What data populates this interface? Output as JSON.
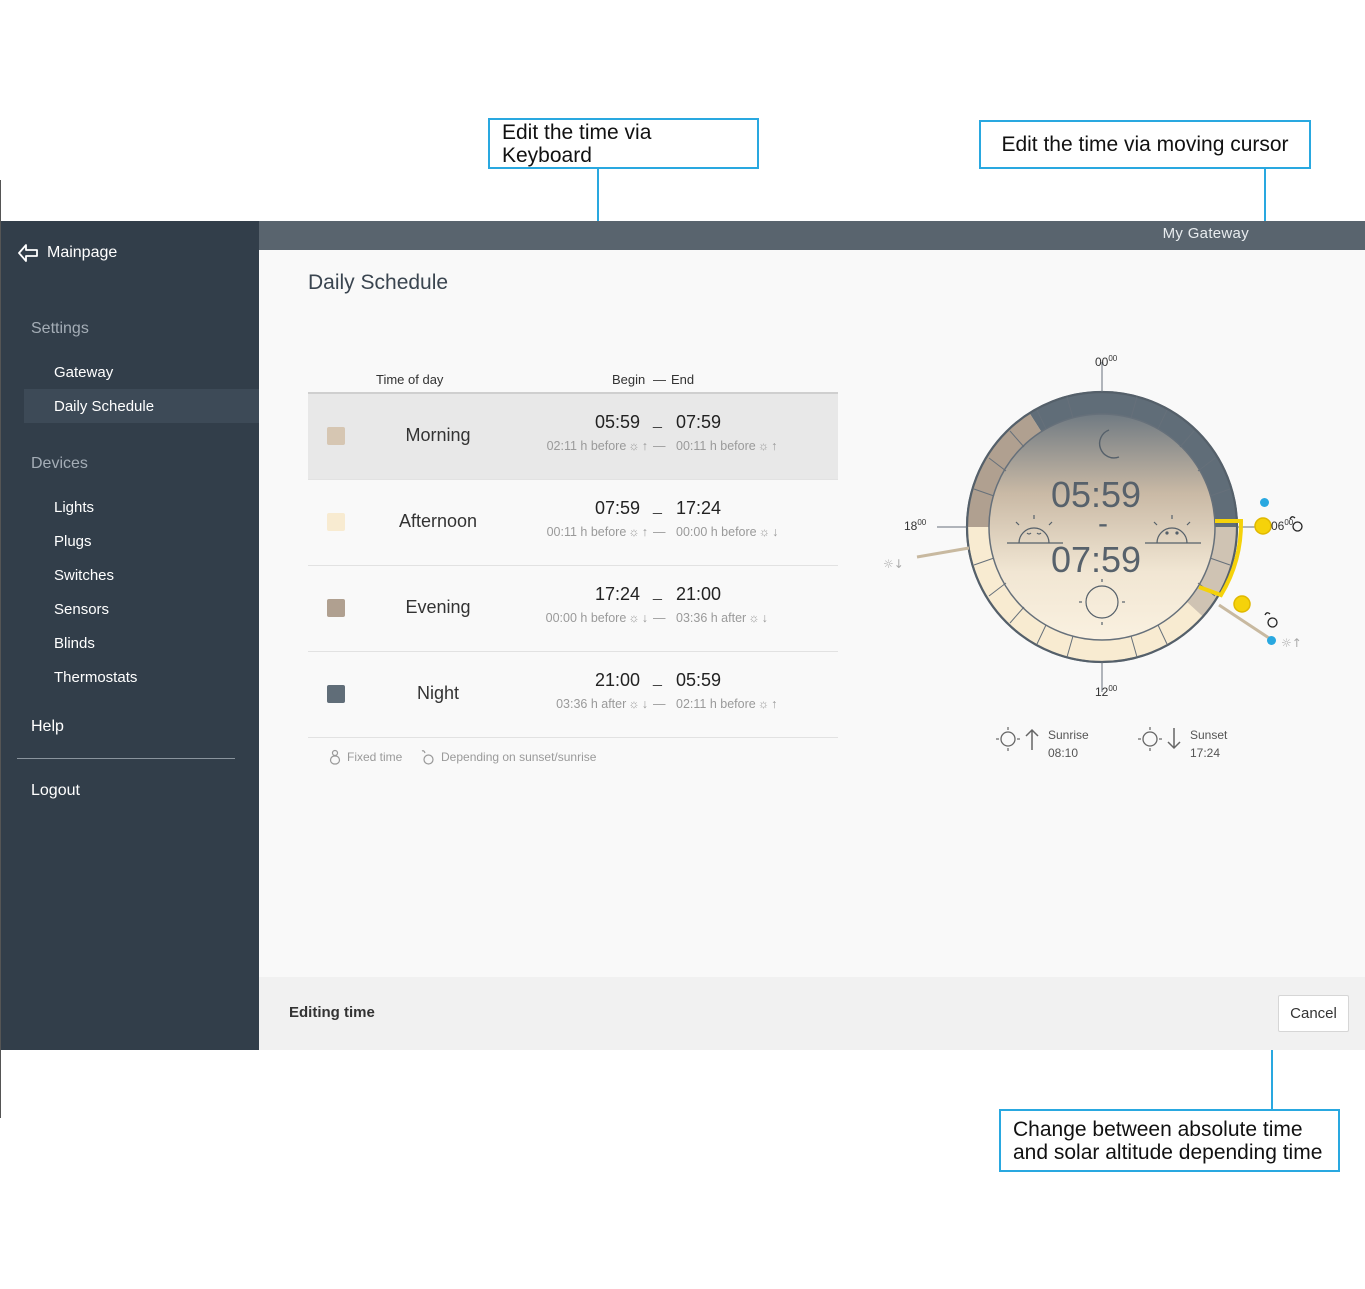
{
  "annotations": {
    "keyboard": "Edit the time via Keyboard",
    "cursor": "Edit the time via moving cursor",
    "toggle_line1": "Change between absolute time",
    "toggle_line2": "and solar altitude depending time"
  },
  "header": {
    "gateway_name": "My Gateway"
  },
  "sidebar": {
    "back_label": "Mainpage",
    "settings_label": "Settings",
    "settings_items": [
      {
        "label": "Gateway"
      },
      {
        "label": "Daily Schedule",
        "active": true
      }
    ],
    "devices_label": "Devices",
    "device_items": [
      {
        "label": "Lights"
      },
      {
        "label": "Plugs"
      },
      {
        "label": "Switches"
      },
      {
        "label": "Sensors"
      },
      {
        "label": "Blinds"
      },
      {
        "label": "Thermostats"
      }
    ],
    "help_label": "Help",
    "logout_label": "Logout"
  },
  "main": {
    "title": "Daily Schedule",
    "columns": {
      "time_of_day": "Time of day",
      "begin": "Begin",
      "dash": "—",
      "end": "End"
    },
    "rows": [
      {
        "name": "Morning",
        "color": "#d6c6b2",
        "begin": "05:59",
        "end": "07:59",
        "begin_rel": "02:11 h before",
        "begin_dir": "↑",
        "end_rel": "00:11 h before",
        "end_dir": "↑",
        "selected": true
      },
      {
        "name": "Afternoon",
        "color": "#f8ebd1",
        "begin": "07:59",
        "end": "17:24",
        "begin_rel": "00:11 h before",
        "begin_dir": "↑",
        "end_rel": "00:00 h before",
        "end_dir": "↓"
      },
      {
        "name": "Evening",
        "color": "#b0a090",
        "begin": "17:24",
        "end": "21:00",
        "begin_rel": "00:00 h before",
        "begin_dir": "↓",
        "end_rel": "03:36 h after",
        "end_dir": "↓"
      },
      {
        "name": "Night",
        "color": "#606d78",
        "begin": "21:00",
        "end": "05:59",
        "begin_rel": "03:36 h after",
        "begin_dir": "↓",
        "end_rel": "02:11 h before",
        "end_dir": "↑"
      }
    ],
    "legend": {
      "fixed": "Fixed time",
      "depending": "Depending on sunset/sunrise"
    }
  },
  "clock": {
    "start": "05:59",
    "separator": "-",
    "end": "07:59",
    "hour_labels": {
      "top": "00",
      "left": "18",
      "right": "06",
      "bottom": "12",
      "minutes": "00"
    },
    "sunrise_label": "Sunrise",
    "sunrise_time": "08:10",
    "sunset_label": "Sunset",
    "sunset_time": "17:24"
  },
  "footer": {
    "title": "Editing time",
    "cancel_label": "Cancel"
  },
  "colors": {
    "sidebar": "#323e4a",
    "topbar": "#59646e",
    "accent": "#29a8e0",
    "highlight": "#f5d20a"
  }
}
